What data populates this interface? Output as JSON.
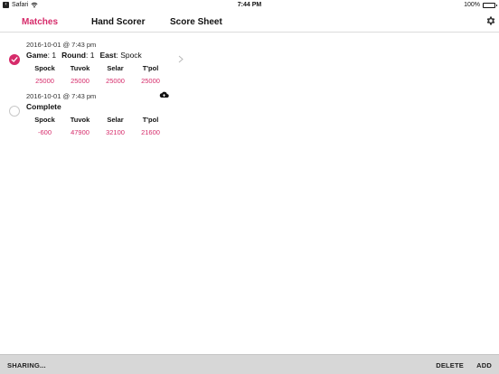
{
  "status_bar": {
    "back_app": "Safari",
    "time": "7:44 PM",
    "battery": "100%"
  },
  "nav": {
    "tabs": [
      {
        "label": "Matches",
        "active": true
      },
      {
        "label": "Hand Scorer",
        "active": false
      },
      {
        "label": "Score Sheet",
        "active": false
      }
    ]
  },
  "matches": [
    {
      "date": "2016-10-01 @ 7:43 pm",
      "selected": true,
      "game_label": "Game",
      "game_value": "1",
      "round_label": "Round",
      "round_value": "1",
      "east_label": "East",
      "east_value": "Spock",
      "players": [
        {
          "name": "Spock",
          "score": "25000"
        },
        {
          "name": "Tuvok",
          "score": "25000"
        },
        {
          "name": "Selar",
          "score": "25000"
        },
        {
          "name": "T'pol",
          "score": "25000"
        }
      ]
    },
    {
      "date": "2016-10-01 @ 7:43 pm",
      "selected": false,
      "status": "Complete",
      "players": [
        {
          "name": "Spock",
          "score": "-600"
        },
        {
          "name": "Tuvok",
          "score": "47900"
        },
        {
          "name": "Selar",
          "score": "32100"
        },
        {
          "name": "T'pol",
          "score": "21600"
        }
      ]
    }
  ],
  "toolbar": {
    "sharing": "SHARING...",
    "delete": "DELETE",
    "add": "ADD"
  },
  "colors": {
    "accent": "#d62b6a",
    "toolbar_bg": "#d7d7d7"
  }
}
